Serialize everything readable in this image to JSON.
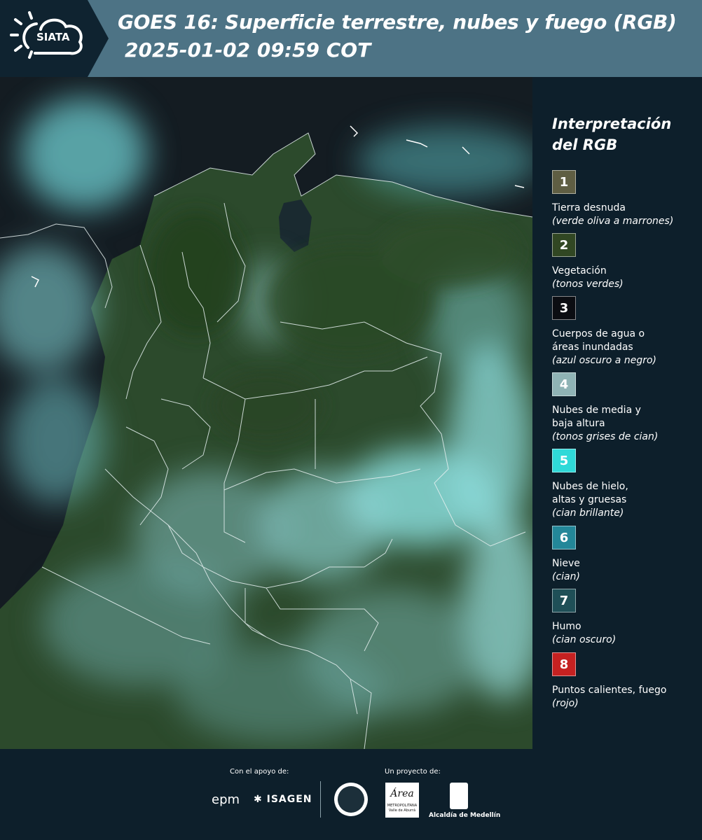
{
  "header": {
    "logo_text": "SIATA",
    "title": "GOES 16: Superficie terrestre, nubes y fuego (RGB)",
    "subtitle": "2025-01-02 09:59 COT"
  },
  "legend": {
    "title": "Interpretación del RGB",
    "items": [
      {
        "num": "1",
        "label": "Tierra desnuda",
        "desc": "(verde oliva a marrones)",
        "color": "#5f5e43"
      },
      {
        "num": "2",
        "label": "Vegetación",
        "desc": "(tonos verdes)",
        "color": "#314723"
      },
      {
        "num": "3",
        "label": "Cuerpos de agua o áreas inundadas",
        "desc": "(azul oscuro a negro)",
        "color": "#0b0d12"
      },
      {
        "num": "4",
        "label": "Nubes de media y baja altura",
        "desc": "(tonos grises de cian)",
        "color": "#8fb3b5"
      },
      {
        "num": "5",
        "label": "Nubes de hielo, altas y gruesas",
        "desc": "(cian brillante)",
        "color": "#2fd9d8"
      },
      {
        "num": "6",
        "label": "Nieve",
        "desc": "(cian)",
        "color": "#238799"
      },
      {
        "num": "7",
        "label": "Humo",
        "desc": "(cian oscuro)",
        "color": "#1f4f57"
      },
      {
        "num": "8",
        "label": "Puntos calientes, fuego",
        "desc": "(rojo)",
        "color": "#c52121"
      }
    ]
  },
  "footer": {
    "support_label": "Con el apoyo de:",
    "project_label": "Un proyecto de:",
    "sponsor_1": "epm",
    "sponsor_2": "ISAGEN",
    "partner_area_title": "Área",
    "partner_area_small": "METROPOLITANA Valle de Aburrá",
    "partner_medellin": "Alcaldía de Medellín"
  },
  "colors": {
    "header_bg": "#4d7385",
    "panel_bg": "#0d1f2b",
    "vegetation": "#2f4a2b",
    "cloud": "#7fcfcf"
  }
}
